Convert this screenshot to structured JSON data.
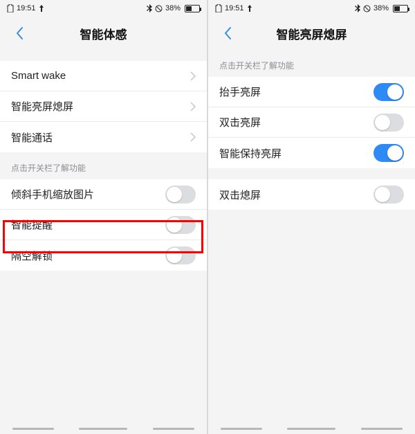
{
  "status": {
    "time": "19:51",
    "battery_pct": "38%"
  },
  "left": {
    "title": "智能体感",
    "nav_rows": [
      {
        "label": "Smart wake"
      },
      {
        "label": "智能亮屏熄屏"
      },
      {
        "label": "智能通话"
      }
    ],
    "group_header": "点击开关栏了解功能",
    "toggle_rows": [
      {
        "label": "倾斜手机缩放图片",
        "on": false
      },
      {
        "label": "智能提醒",
        "on": false
      },
      {
        "label": "隔空解锁",
        "on": false,
        "highlighted": true
      }
    ]
  },
  "right": {
    "title": "智能亮屏熄屏",
    "group_header": "点击开关栏了解功能",
    "toggle_rows_a": [
      {
        "label": "抬手亮屏",
        "on": true
      },
      {
        "label": "双击亮屏",
        "on": false
      },
      {
        "label": "智能保持亮屏",
        "on": true
      }
    ],
    "toggle_rows_b": [
      {
        "label": "双击熄屏",
        "on": false
      }
    ]
  }
}
